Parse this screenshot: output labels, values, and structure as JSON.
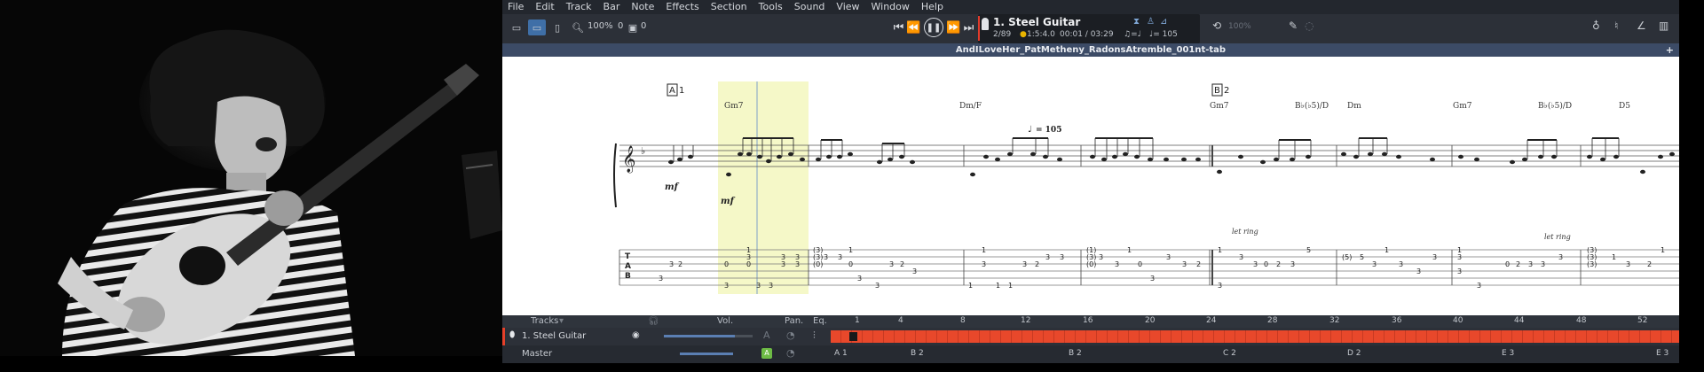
{
  "menu": [
    "File",
    "Edit",
    "Track",
    "Bar",
    "Note",
    "Effects",
    "Section",
    "Tools",
    "Sound",
    "View",
    "Window",
    "Help"
  ],
  "toolbar": {
    "zoom": "100%",
    "counter_a": "0",
    "counter_b": "0"
  },
  "lcd": {
    "track_title": "1. Steel Guitar",
    "bar_position": "2/89",
    "time_signature": "1:5:4.0",
    "time": "00:01 / 03:29",
    "tempo_label": "♩= 105",
    "tempo_ratio": "♫=♩",
    "volume_pct": "100%"
  },
  "document": {
    "title": "AndILoveHer_PatMetheny_RadonsAtremble_001nt-tab"
  },
  "score": {
    "sections": [
      {
        "letter": "A",
        "number": "1"
      },
      {
        "letter": "B",
        "number": "2"
      }
    ],
    "chords": [
      "Gm7",
      "Dm/F",
      "Gm7",
      "B♭(♭5)/D",
      "Dm",
      "Gm7",
      "B♭(♭5)/D",
      "D5"
    ],
    "tempo_marking": "= 105",
    "dynamic": "mf",
    "let_ring": "let ring",
    "tab_clef": [
      "T",
      "A",
      "B"
    ]
  },
  "tracks_panel": {
    "header_tracks": "Tracks",
    "header_vol": "Vol.",
    "header_pan": "Pan.",
    "header_eq": "Eq.",
    "ruler": [
      "1",
      "4",
      "8",
      "12",
      "16",
      "20",
      "24",
      "28",
      "32",
      "36",
      "40",
      "44",
      "48",
      "52"
    ],
    "track_name": "1. Steel Guitar",
    "master_name": "Master",
    "section_marks": [
      "A 1",
      "B 2",
      "B 2",
      "C 2",
      "D 2",
      "E 3",
      "E 3"
    ]
  },
  "colors": {
    "accent_red": "#e4402a",
    "timeline_red": "#e8482b",
    "selection_yellow": "#f5f8c8",
    "doc_bar": "#3c4b66"
  }
}
